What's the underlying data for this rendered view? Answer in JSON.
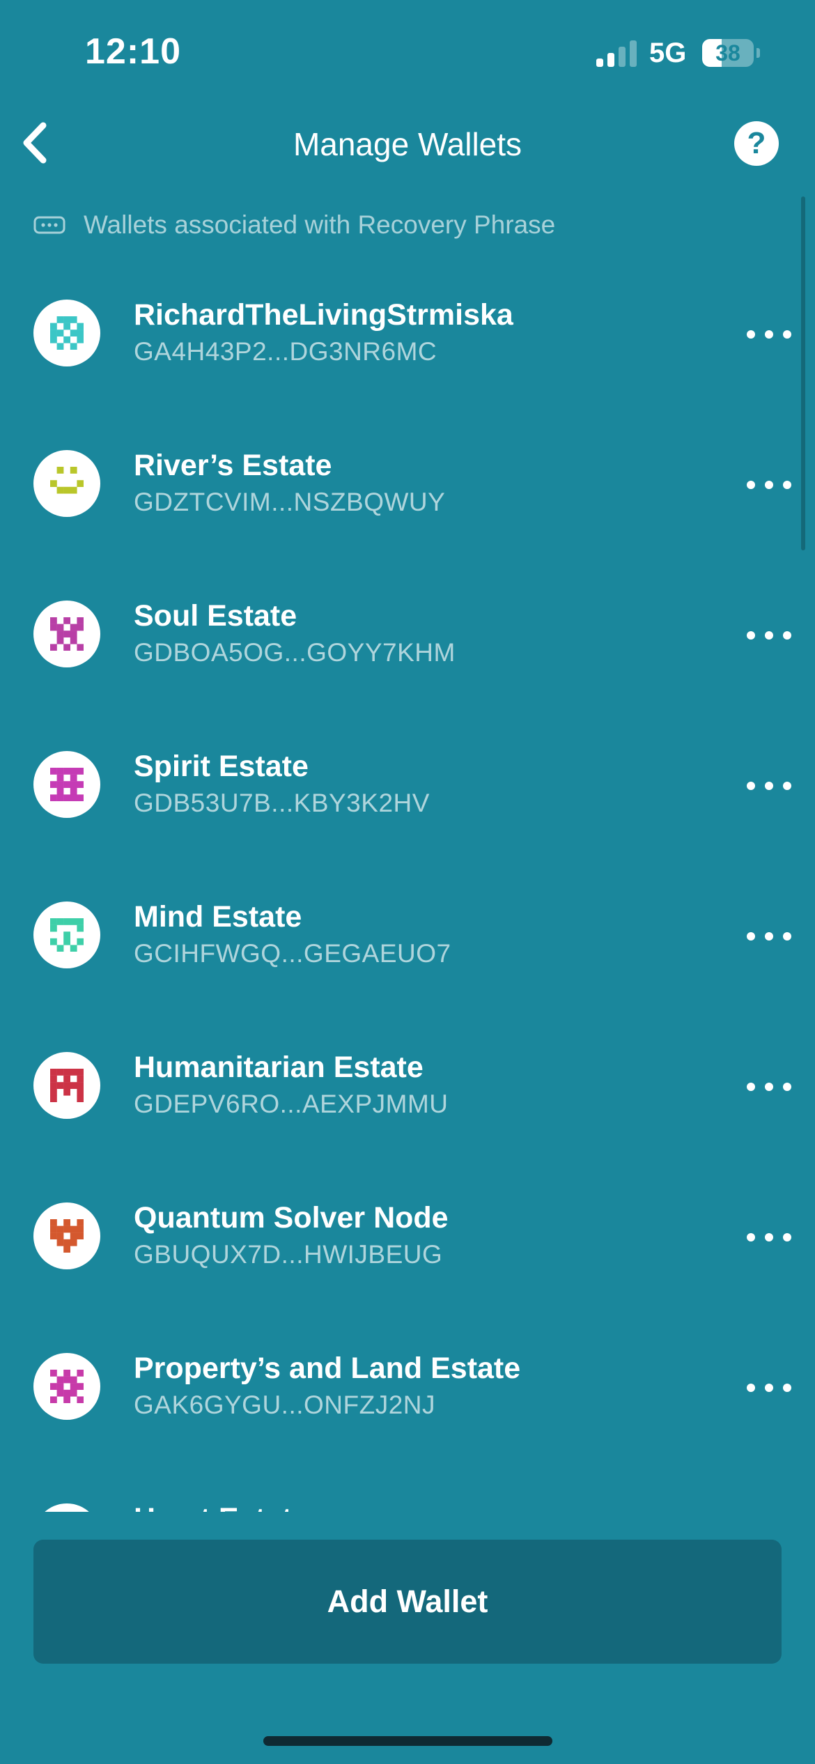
{
  "status_bar": {
    "time": "12:10",
    "network": "5G",
    "battery_level": "38",
    "battery_fraction": 0.38,
    "signal_bars_active": 2,
    "signal_bars_total": 4
  },
  "header": {
    "title": "Manage Wallets",
    "back_icon": "chevron-left-icon",
    "help_label": "?"
  },
  "section": {
    "icon": "ellipsis-box-icon",
    "label": "Wallets associated with Recovery Phrase"
  },
  "wallets": [
    {
      "name": "RichardTheLivingStrmiska",
      "address": "GA4H43P2...DG3NR6MC",
      "avatar_color": "#3bc6c6"
    },
    {
      "name": "River’s Estate",
      "address": "GDZTCVIM...NSZBQWUY",
      "avatar_color": "#b9c62a"
    },
    {
      "name": "Soul Estate",
      "address": "GDBOA5OG...GOYY7KHM",
      "avatar_color": "#b83fa6"
    },
    {
      "name": "Spirit Estate",
      "address": "GDB53U7B...KBY3K2HV",
      "avatar_color": "#c53bb5"
    },
    {
      "name": "Mind Estate",
      "address": "GCIHFWGQ...GEGAEUO7",
      "avatar_color": "#3ecfa8"
    },
    {
      "name": "Humanitarian Estate",
      "address": "GDEPV6RO...AEXPJMMU",
      "avatar_color": "#cc3346"
    },
    {
      "name": "Quantum Solver Node",
      "address": "GBUQUX7D...HWIJBEUG",
      "avatar_color": "#d4582e"
    },
    {
      "name": "Property’s and Land Estate",
      "address": "GAK6GYGU...ONFZJ2NJ",
      "avatar_color": "#c73aa9"
    },
    {
      "name": "Heart Estate",
      "address": "",
      "avatar_color": "#cccccc"
    }
  ],
  "footer": {
    "add_wallet_label": "Add Wallet"
  },
  "colors": {
    "background": "#1a879c",
    "button": "#14687b",
    "text": "#ffffff"
  }
}
